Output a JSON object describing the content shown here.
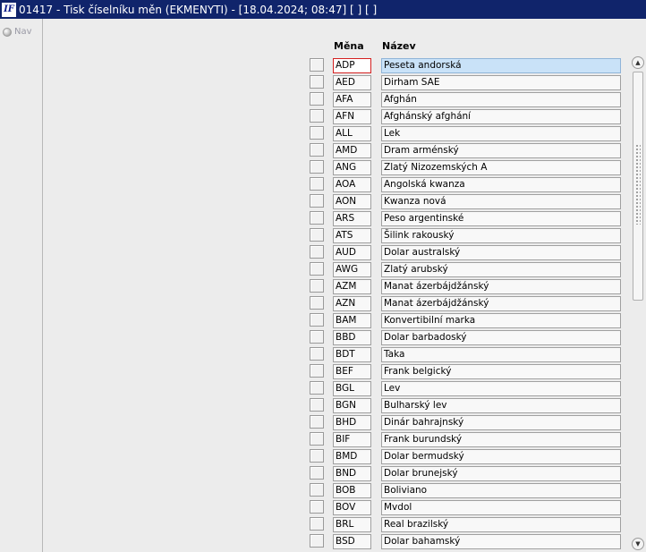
{
  "window": {
    "icon_label": "IF",
    "title": "01417 - Tisk číselníku měn (EKMENYTI) - [18.04.2024; 08:47]  [ ]  [ ]"
  },
  "nav": {
    "label": "Nav"
  },
  "columns": {
    "code": "Měna",
    "name": "Název"
  },
  "rows": [
    {
      "code": "ADP",
      "name": "Peseta andorská"
    },
    {
      "code": "AED",
      "name": "Dirham SAE"
    },
    {
      "code": "AFA",
      "name": "Afghán"
    },
    {
      "code": "AFN",
      "name": "Afghánský afghání"
    },
    {
      "code": "ALL",
      "name": "Lek"
    },
    {
      "code": "AMD",
      "name": "Dram arménský"
    },
    {
      "code": "ANG",
      "name": "Zlatý Nizozemských A"
    },
    {
      "code": "AOA",
      "name": "Angolská kwanza"
    },
    {
      "code": "AON",
      "name": "Kwanza nová"
    },
    {
      "code": "ARS",
      "name": "Peso argentinské"
    },
    {
      "code": "ATS",
      "name": "Šilink rakouský"
    },
    {
      "code": "AUD",
      "name": "Dolar australský"
    },
    {
      "code": "AWG",
      "name": "Zlatý arubský"
    },
    {
      "code": "AZM",
      "name": "Manat ázerbájdžánský"
    },
    {
      "code": "AZN",
      "name": "Manat ázerbájdžánský"
    },
    {
      "code": "BAM",
      "name": "Konvertibilní marka"
    },
    {
      "code": "BBD",
      "name": "Dolar barbadoský"
    },
    {
      "code": "BDT",
      "name": "Taka"
    },
    {
      "code": "BEF",
      "name": "Frank belgický"
    },
    {
      "code": "BGL",
      "name": "Lev"
    },
    {
      "code": "BGN",
      "name": "Bulharský lev"
    },
    {
      "code": "BHD",
      "name": "Dinár bahrajnský"
    },
    {
      "code": "BIF",
      "name": "Frank burundský"
    },
    {
      "code": "BMD",
      "name": "Dolar bermudský"
    },
    {
      "code": "BND",
      "name": "Dolar brunejský"
    },
    {
      "code": "BOB",
      "name": "Boliviano"
    },
    {
      "code": "BOV",
      "name": "Mvdol"
    },
    {
      "code": "BRL",
      "name": "Real brazilský"
    },
    {
      "code": "BSD",
      "name": "Dolar bahamský"
    }
  ],
  "active_row_index": 0,
  "scrollbar": {
    "up_icon": "arrow-up-icon",
    "down_icon": "arrow-down-icon"
  },
  "colors": {
    "titlebar": "#10246b",
    "active_name_bg": "#c9e2f8",
    "active_code_border": "#d42020"
  }
}
